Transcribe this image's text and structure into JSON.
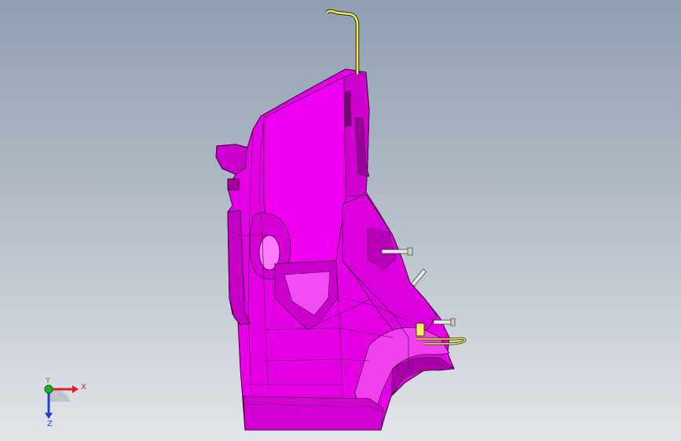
{
  "viewport": {
    "colors": {
      "background_top": "#8f9fb2",
      "background_bottom": "#e3e6ea",
      "part_fill": "#e600e6",
      "part_shade": "#b300b3",
      "part_light": "#ff66ff",
      "edge": "#3a003a",
      "bracket_wire": "#f2ef5a",
      "pin_fill": "#e8e8e8"
    }
  },
  "triad": {
    "x_label": "X",
    "y_label": "Y",
    "z_label": "Z",
    "x_color": "#e02020",
    "y_color": "#20b020",
    "z_color": "#2040d0"
  }
}
